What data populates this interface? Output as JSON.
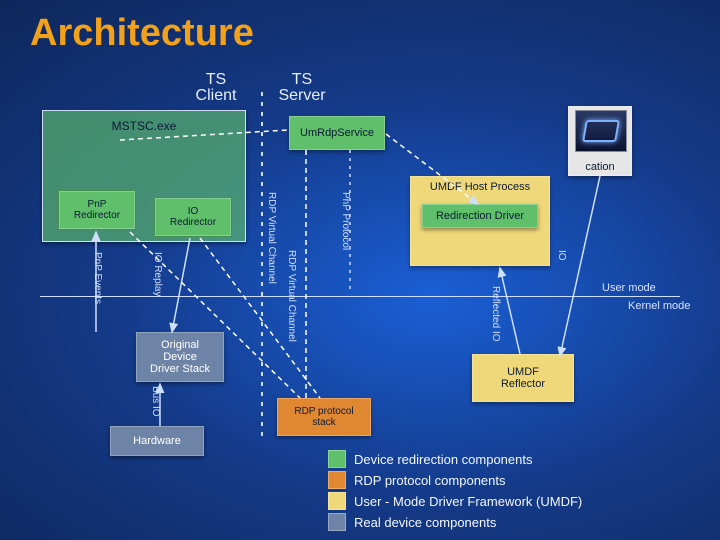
{
  "title": "Architecture",
  "columns": {
    "client": "TS\nClient",
    "server": "TS\nServer"
  },
  "mstsc": {
    "label": "MSTSC.exe",
    "pnp": "PnP\nRedirector",
    "io": "IO\nRedirector"
  },
  "umrdp": "UmRdpService",
  "umdf_host": {
    "label": "UMDF Host Process",
    "driver": "Redirection Driver"
  },
  "boxes": {
    "orig": "Original\nDevice\nDriver Stack",
    "hw": "Hardware",
    "rdpstack": "RDP protocol\nstack",
    "reflector": "UMDF\nReflector",
    "app": "cation"
  },
  "arrows": {
    "pnp_events": "PnP Events",
    "io_replay": "IO Replay",
    "bus_io": "Bus IO",
    "rdp_vc1": "RDP Virtual Channel",
    "rdp_vc2": "RDP Virtual Channel",
    "pnp_proto": "PnP Protocol",
    "reflected": "Reflected IO",
    "appio": "IO"
  },
  "modes": {
    "user": "User mode",
    "kernel": "Kernel mode"
  },
  "legend": [
    {
      "color": "#5fbf6b",
      "text": "Device redirection components"
    },
    {
      "color": "#e08732",
      "text": "RDP protocol components"
    },
    {
      "color": "#efd879",
      "text": "User - Mode Driver Framework (UMDF)"
    },
    {
      "color": "#6d84a7",
      "text": "Real device components"
    }
  ]
}
